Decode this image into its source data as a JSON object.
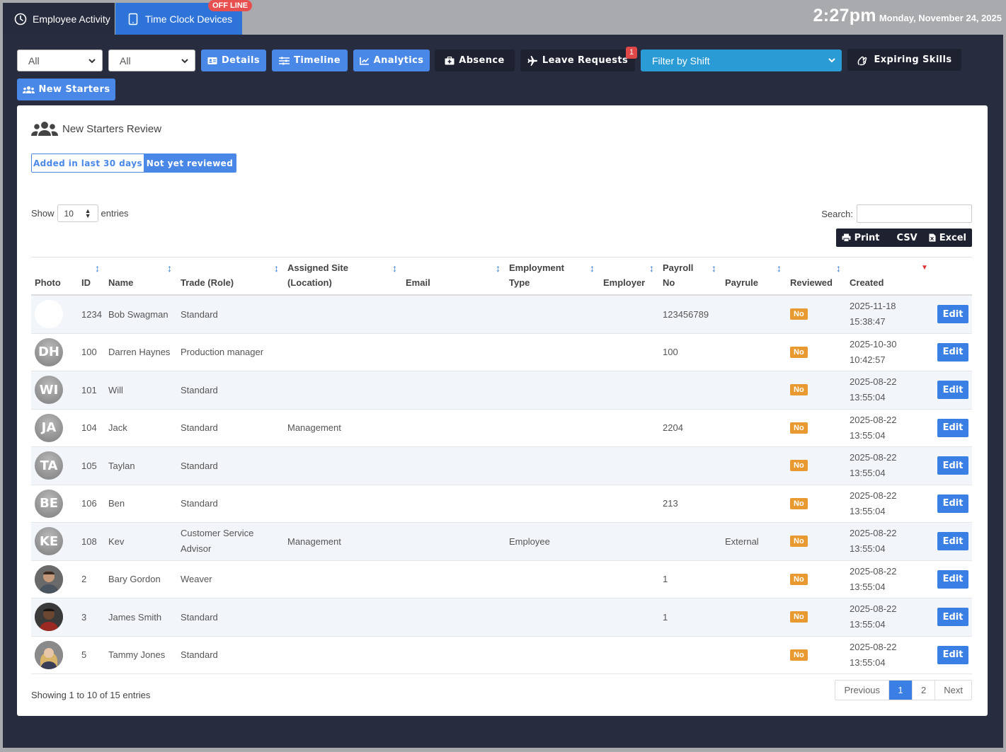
{
  "tabs": {
    "activity": "Employee Activity",
    "devices": "Time Clock Devices",
    "offline_badge": "OFF LINE"
  },
  "clock": {
    "time": "2:27pm",
    "date": "Monday, November 24, 2025"
  },
  "toolbar": {
    "select1": "All",
    "select2": "All",
    "details": "Details",
    "timeline": "Timeline",
    "analytics": "Analytics",
    "absence": "Absence",
    "leave_requests": "Leave Requests",
    "leave_badge": "1",
    "filter_shift": "Filter by Shift",
    "expiring_skills": "Expiring Skills",
    "new_starters": "New Starters"
  },
  "card": {
    "title": "New Starters Review",
    "filter_added": "Added in last 30 days",
    "filter_not_reviewed": "Not yet reviewed",
    "show_label": "Show",
    "entries_label": "entries",
    "page_length": "10",
    "search_label": "Search:",
    "print": "Print",
    "csv": "CSV",
    "excel": "Excel"
  },
  "table": {
    "headers": {
      "photo": "Photo",
      "id": "ID",
      "name": "Name",
      "trade": "Trade (Role)",
      "site_1": "Assigned Site",
      "site_2": "(Location)",
      "email": "Email",
      "emp_type_1": "Employment",
      "emp_type_2": "Type",
      "employer": "Employer",
      "payroll_1": "Payroll",
      "payroll_2": "No",
      "payrule": "Payrule",
      "reviewed": "Reviewed",
      "created": "Created"
    },
    "rows": [
      {
        "avatar": "",
        "avatar_style": "blank",
        "id": "1234",
        "name": "Bob Swagman",
        "trade": "Standard",
        "trade2": "",
        "site": "",
        "email": "",
        "emp_type": "",
        "employer": "",
        "payroll": "123456789",
        "payrule": "",
        "reviewed": "No",
        "created_date": "2025-11-18",
        "created_time": "15:38:47",
        "edit": "Edit"
      },
      {
        "avatar": "DH",
        "avatar_style": "initials",
        "id": "100",
        "name": "Darren Haynes",
        "trade": "Production manager",
        "trade2": "",
        "site": "",
        "email": "",
        "emp_type": "",
        "employer": "",
        "payroll": "100",
        "payrule": "",
        "reviewed": "No",
        "created_date": "2025-10-30",
        "created_time": "10:42:57",
        "edit": "Edit"
      },
      {
        "avatar": "WI",
        "avatar_style": "initials",
        "id": "101",
        "name": "Will",
        "trade": "Standard",
        "trade2": "",
        "site": "",
        "email": "",
        "emp_type": "",
        "employer": "",
        "payroll": "",
        "payrule": "",
        "reviewed": "No",
        "created_date": "2025-08-22",
        "created_time": "13:55:04",
        "edit": "Edit"
      },
      {
        "avatar": "JA",
        "avatar_style": "initials",
        "id": "104",
        "name": "Jack",
        "trade": "Standard",
        "trade2": "",
        "site": "Management",
        "email": "",
        "emp_type": "",
        "employer": "",
        "payroll": "2204",
        "payrule": "",
        "reviewed": "No",
        "created_date": "2025-08-22",
        "created_time": "13:55:04",
        "edit": "Edit"
      },
      {
        "avatar": "TA",
        "avatar_style": "initials",
        "id": "105",
        "name": "Taylan",
        "trade": "Standard",
        "trade2": "",
        "site": "",
        "email": "",
        "emp_type": "",
        "employer": "",
        "payroll": "",
        "payrule": "",
        "reviewed": "No",
        "created_date": "2025-08-22",
        "created_time": "13:55:04",
        "edit": "Edit"
      },
      {
        "avatar": "BE",
        "avatar_style": "initials",
        "id": "106",
        "name": "Ben",
        "trade": "Standard",
        "trade2": "",
        "site": "",
        "email": "",
        "emp_type": "",
        "employer": "",
        "payroll": "213",
        "payrule": "",
        "reviewed": "No",
        "created_date": "2025-08-22",
        "created_time": "13:55:04",
        "edit": "Edit"
      },
      {
        "avatar": "KE",
        "avatar_style": "initials",
        "id": "108",
        "name": "Kev",
        "trade": "Customer Service",
        "trade2": "Advisor",
        "site": "Management",
        "email": "",
        "emp_type": "Employee",
        "employer": "",
        "payroll": "",
        "payrule": "External",
        "reviewed": "No",
        "created_date": "2025-08-22",
        "created_time": "13:55:04",
        "edit": "Edit"
      },
      {
        "avatar": "",
        "avatar_style": "photo-a",
        "id": "2",
        "name": "Bary Gordon",
        "trade": "Weaver",
        "trade2": "",
        "site": "",
        "email": "",
        "emp_type": "",
        "employer": "",
        "payroll": "1",
        "payrule": "",
        "reviewed": "No",
        "created_date": "2025-08-22",
        "created_time": "13:55:04",
        "edit": "Edit"
      },
      {
        "avatar": "",
        "avatar_style": "photo-b",
        "id": "3",
        "name": "James Smith",
        "trade": "Standard",
        "trade2": "",
        "site": "",
        "email": "",
        "emp_type": "",
        "employer": "",
        "payroll": "1",
        "payrule": "",
        "reviewed": "No",
        "created_date": "2025-08-22",
        "created_time": "13:55:04",
        "edit": "Edit"
      },
      {
        "avatar": "",
        "avatar_style": "photo-c",
        "id": "5",
        "name": "Tammy Jones",
        "trade": "Standard",
        "trade2": "",
        "site": "",
        "email": "",
        "emp_type": "",
        "employer": "",
        "payroll": "",
        "payrule": "",
        "reviewed": "No",
        "created_date": "2025-08-22",
        "created_time": "13:55:04",
        "edit": "Edit"
      }
    ]
  },
  "footer": {
    "info": "Showing 1 to 10 of 15 entries",
    "previous": "Previous",
    "page1": "1",
    "page2": "2",
    "next": "Next"
  },
  "colors": {
    "accent_blue": "#4a88e8",
    "dark_bg": "#272c3f",
    "no_badge": "#e89a30",
    "shift_select": "#2b9bd6"
  }
}
